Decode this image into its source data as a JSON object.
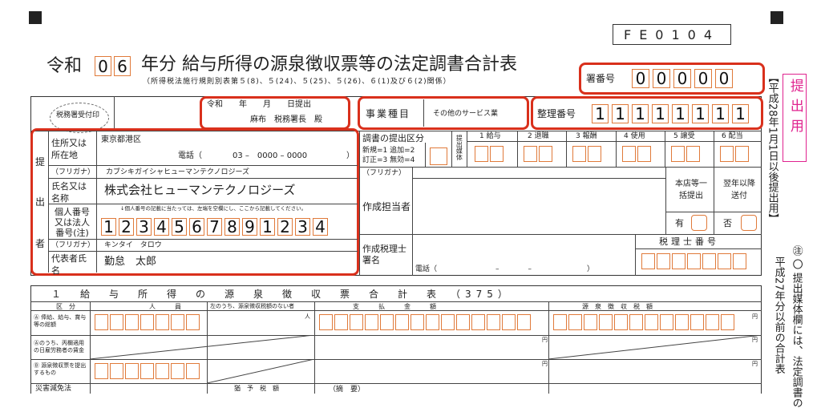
{
  "form_code": "FE0104",
  "era": "令和",
  "year_digits": [
    "0",
    "6"
  ],
  "title": "年分 給与所得の源泉徴収票等の法定調書合計表",
  "subtitle": "（所得税法施行規則別表第５(8)、５(24)、５(25)、５(26)、６(1)及び６(2)関係）",
  "sheet_no": {
    "label": "署番号",
    "digits": [
      "0",
      "0",
      "0",
      "0",
      "0"
    ]
  },
  "side_note_top": "【平成28年1月1日以後提出用】",
  "teishutsu": "提出用",
  "side_note_bottom": "㊟ 〇 提出媒体欄には、法定調書の",
  "side_note_bottom2": "平成27年分以前の合計表",
  "header_row": {
    "stamp": "税務署受付印",
    "date_line": "令和　　年　　月　　日提出",
    "office_line": "麻布　税務署長　殿",
    "business_label": "事業種目",
    "business_value": "その他のサービス業",
    "ref_label": "整理番号",
    "ref_digits": [
      "1",
      "1",
      "1",
      "1",
      "1",
      "1",
      "1",
      "1"
    ]
  },
  "teishutsusha": {
    "side": [
      "提",
      "出",
      "者"
    ],
    "address_label": "住所又は所在地",
    "address_value": "東京都港区",
    "phone_label": "電話（",
    "phone_value": "03 –　0000 – 0000",
    "phone_close": "）",
    "furigana_label": "（フリガナ）",
    "furigana_value": "カブシキガイシャヒューマンテクノロジーズ",
    "name_label": "氏名又は名称",
    "name_value": "株式会社ヒューマンテクノロジーズ",
    "id_label": "個人番号又は法人番号(注)",
    "id_note": "↓個人番号の記載に当たっては、左端を空欄にし、ここから記載してください。",
    "id_digits": [
      "1",
      "2",
      "3",
      "4",
      "5",
      "6",
      "7",
      "8",
      "9",
      "1",
      "2",
      "3",
      "4"
    ],
    "rep_furigana_label": "（フリガナ）",
    "rep_furigana_value": "キンタイ　タロウ",
    "rep_label": "代表者氏名",
    "rep_value": "勤怠　太郎"
  },
  "right_block": {
    "kubun_label": "調書の提出区分",
    "kubun_note1": "新規=1 追加=2",
    "kubun_note2": "訂正=3 無効=4",
    "media_label": "提出媒体",
    "cols": [
      "1 給与",
      "2 退職",
      "3 報酬",
      "4 使用",
      "5 譲受",
      "6 配当"
    ],
    "furigana_label": "（フリガナ）",
    "tantou_label": "作成担当者",
    "honten_label": "本店等一括提出",
    "yokunen_label": "翌年以降送付",
    "yes": "有",
    "no": "否",
    "zeirishi_label": "作成税理士署名",
    "zeirishi_no_label": "税理士番号",
    "phone_label": "電話（",
    "phone_dash": "–　　　　–",
    "phone_close": "）"
  },
  "section1": {
    "title": "１　給　与　所　得　の　源　泉　徴　収　票　合　計　表　（375）",
    "col_kubun": "区　分",
    "col_people": "人　　　員",
    "col_exempt": "左のうち、源泉徴収税額のない者",
    "col_paid": "支　　　払　　　金　　　額",
    "col_tax": "源　泉　徴　収　税　額",
    "unit_person": "人",
    "unit_yen": "円",
    "rows": [
      "Ⓐ 俸給、給与、賞与等の総額",
      "Ⓐのうち、丙欄適用の日雇労務者の賃金",
      "Ⓑ 源泉徴収票を提出するもの"
    ],
    "bottom_row_label": "災害減免法",
    "bottom_col2": "猶　予　税　額",
    "bottom_col3": "（摘　要）"
  }
}
